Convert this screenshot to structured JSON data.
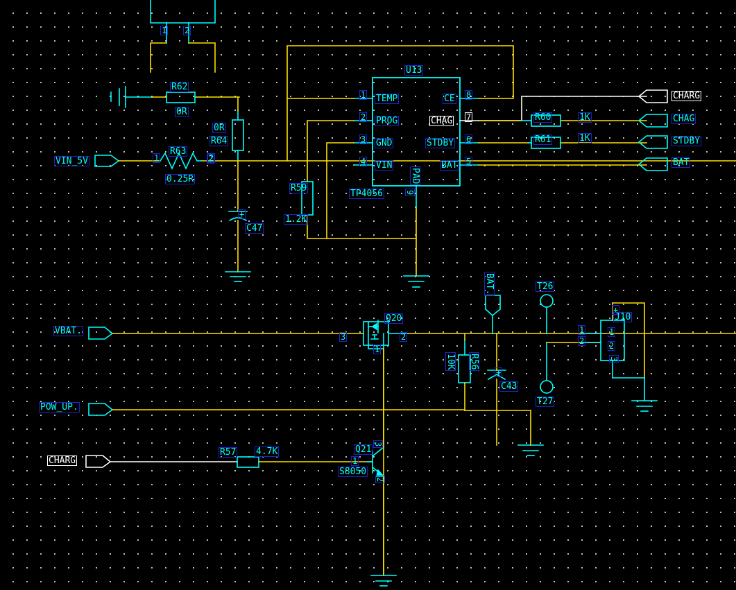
{
  "app": {
    "type": "schematic-editor",
    "background": "#000000",
    "wire_colors": {
      "net": "#00ffff",
      "bus": "#ffe000",
      "selected": "#ffffff"
    },
    "label_color": "#00ffff",
    "label_border": "#2222cc",
    "grid_dot_color": "#ffffff"
  },
  "ports": {
    "left": [
      {
        "name": "VIN_5V",
        "label": "VIN_5V",
        "selected": false
      },
      {
        "name": "VBAT",
        "label": "VBAT.",
        "selected": false
      },
      {
        "name": "POW_UP",
        "label": "POW_UP.",
        "selected": false
      },
      {
        "name": "CHARG",
        "label": "CHARG",
        "selected": true
      }
    ],
    "right": [
      {
        "name": "CHARG",
        "label": "CHARG",
        "selected": true
      },
      {
        "name": "CHAG",
        "label": "CHAG",
        "selected": false
      },
      {
        "name": "STDBY",
        "label": "STDBY",
        "selected": false
      },
      {
        "name": "BAT",
        "label": "BAT",
        "selected": false
      }
    ],
    "net_flag": {
      "name": "BAT",
      "label": "BAT."
    }
  },
  "ic": {
    "refdes": "U13",
    "part": "TP4056",
    "pins_left": [
      {
        "num": "1",
        "name": "TEMP"
      },
      {
        "num": "2",
        "name": "PROG"
      },
      {
        "num": "3",
        "name": "GND"
      },
      {
        "num": "4",
        "name": "VIN"
      }
    ],
    "pins_right": [
      {
        "num": "8",
        "name": "CE",
        "selected": false
      },
      {
        "num": "7",
        "name": "CHAG",
        "selected": true
      },
      {
        "num": "6",
        "name": "STDBY",
        "selected": false
      },
      {
        "num": "5",
        "name": "BAT",
        "selected": false
      }
    ],
    "pin_pad": {
      "num": "9",
      "name": "PAD"
    }
  },
  "components": [
    {
      "refdes": "R62",
      "value": "0R",
      "kind": "resistor"
    },
    {
      "refdes": "R63",
      "value": "0.25R",
      "kind": "resistor-zigzag"
    },
    {
      "refdes": "R64",
      "value": "0R",
      "kind": "resistor-vertical"
    },
    {
      "refdes": "R59",
      "value": "1.2K",
      "kind": "resistor-vertical"
    },
    {
      "refdes": "R60",
      "value": "1K",
      "kind": "resistor"
    },
    {
      "refdes": "R61",
      "value": "1K",
      "kind": "resistor"
    },
    {
      "refdes": "R56",
      "value": "10K",
      "kind": "resistor-vertical"
    },
    {
      "refdes": "R57",
      "value": "4.7K",
      "kind": "resistor"
    },
    {
      "refdes": "C47",
      "value": "",
      "kind": "capacitor-polarized"
    },
    {
      "refdes": "C43",
      "value": "",
      "kind": "capacitor-polarized"
    },
    {
      "refdes": "Q20",
      "value": "",
      "kind": "mosfet-p"
    },
    {
      "refdes": "Q21",
      "value": "S8050",
      "kind": "transistor-npn"
    },
    {
      "refdes": "J10",
      "value": "",
      "kind": "connector"
    },
    {
      "refdes": "T26",
      "value": "",
      "kind": "testpoint"
    },
    {
      "refdes": "T27",
      "value": "",
      "kind": "testpoint"
    }
  ],
  "labels": {
    "r62": "R62",
    "r62_val": "0R",
    "r63": "R63",
    "r63_val": "0.25R",
    "r64": "R64",
    "r64_val": "0R",
    "r59": "R59",
    "r59_val": "1.2K",
    "r60": "R60",
    "r60_val": "1K",
    "r61": "R61",
    "r61_val": "1K",
    "r56": "R56",
    "r56_val": "10K",
    "r57": "R57",
    "r57_val": "4.7K",
    "c47": "C47",
    "c43": "C43",
    "q20": "Q20",
    "q21": "Q21",
    "q21_part": "S8050",
    "j10": "J10",
    "t26": "T26",
    "t27": "T27",
    "u13": "U13",
    "tp4056": "TP4056",
    "plus_c47": "+",
    "plus_c43": "+",
    "plus_j10": "+"
  },
  "pin_numbers": {
    "top_left_1": "1",
    "top_left_2": "2",
    "r63_1": "1",
    "r63_2": "2",
    "r64_2": "2",
    "q20_3": "3",
    "q20_2": "2",
    "q20_1": "1",
    "q21_3": "3",
    "q21_1": "1",
    "q21_2": "2",
    "j10_1a": "1",
    "j10_2a": "2",
    "j10_1b": "1",
    "j10_2b": "2",
    "j10_3": "3"
  }
}
